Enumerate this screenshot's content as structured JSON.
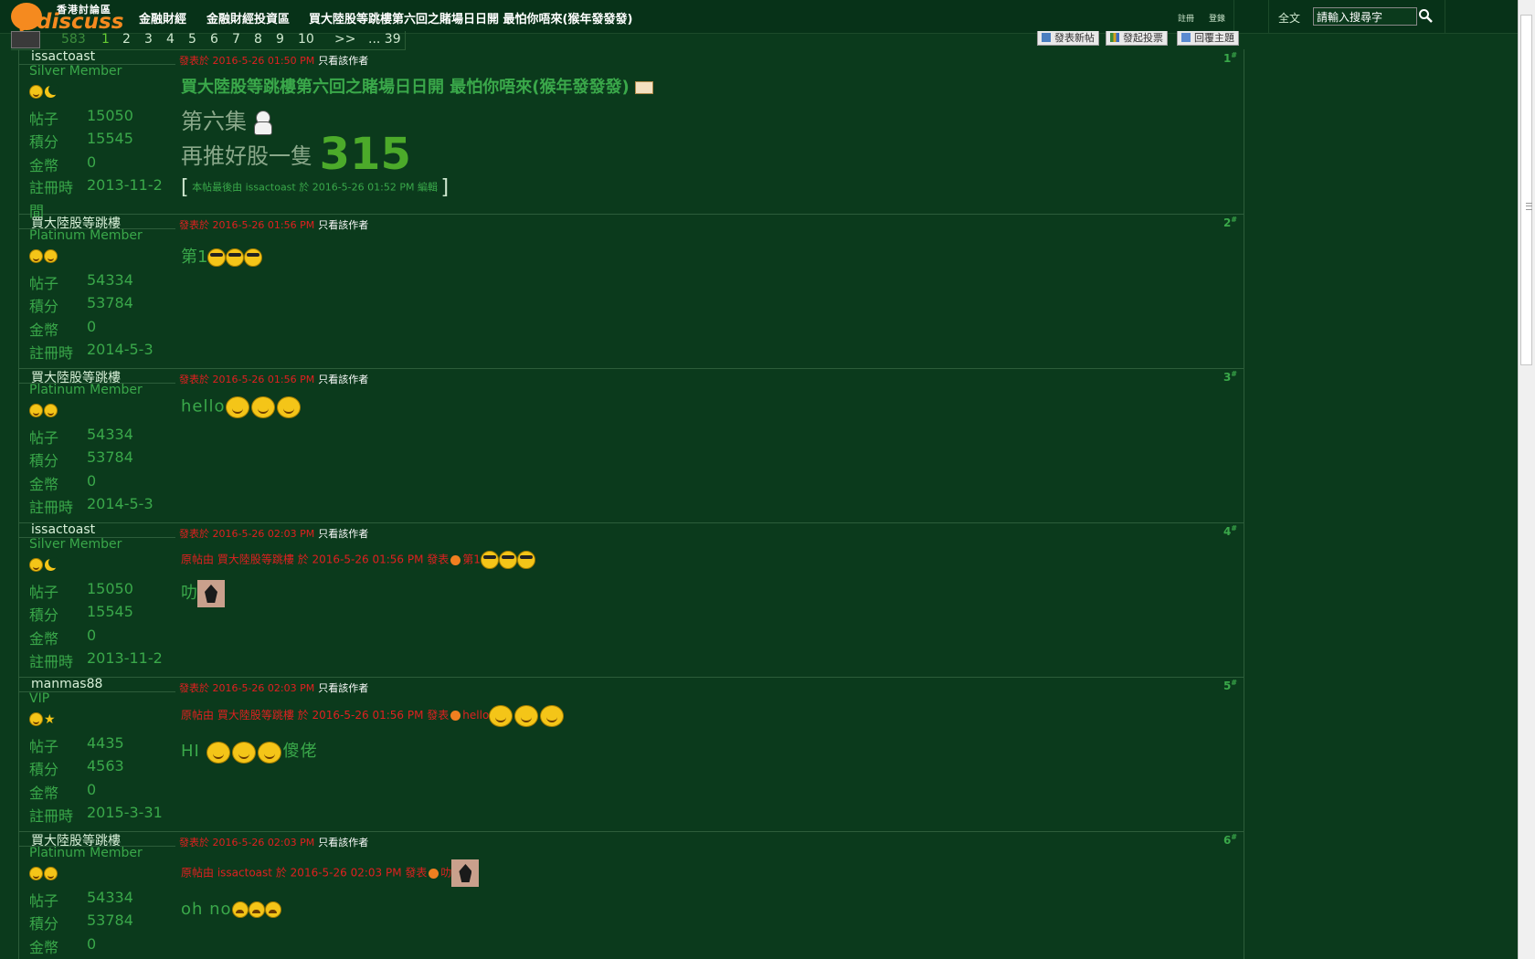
{
  "header": {
    "logo_cn": "香港討論區",
    "logo_en": "discuss",
    "nav": [
      "金融財經",
      "金融財經投資區",
      "買大陸股等跳樓第六回之賭場日日開 最怕你唔來(猴年發發發)"
    ],
    "tiny_links": [
      "註冊",
      "登錄"
    ],
    "search_label": "全文",
    "search_placeholder": "請輸入搜尋字"
  },
  "pager": {
    "total": "583",
    "pages": [
      "1",
      "2",
      "3",
      "4",
      "5",
      "6",
      "7",
      "8",
      "9",
      "10"
    ],
    "next": ">>",
    "last": "... 39"
  },
  "actions": [
    "發表新帖",
    "發起投票",
    "回覆主題"
  ],
  "posts": [
    {
      "author": "issactoast",
      "group": "Silver Member",
      "stats": {
        "posts_k": "帖子",
        "posts": "15050",
        "credits_k": "積分",
        "credits": "15545",
        "money_k": "金幣",
        "money": "0",
        "reg_k": "註冊時間",
        "reg": "2013-11-2"
      },
      "posted_label": "發表於",
      "time": "2016-5-26 01:50 PM",
      "only_author": "只看該作者",
      "floor": "1",
      "title": "買大陸股等跳樓第六回之賭場日日開 最怕你唔來(猴年發發發)",
      "line1": "第六集",
      "line2": "再推好股一隻",
      "stock": "315",
      "edit_note": "本帖最後由 issactoast 於 2016-5-26 01:52 PM 編輯"
    },
    {
      "author": "買大陸股等跳樓",
      "group": "Platinum Member",
      "stats": {
        "posts_k": "帖子",
        "posts": "54334",
        "credits_k": "積分",
        "credits": "53784",
        "money_k": "金幣",
        "money": "0",
        "reg_k": "註冊時",
        "reg": "2014-5-3"
      },
      "posted_label": "發表於",
      "time": "2016-5-26 01:56 PM",
      "only_author": "只看該作者",
      "floor": "2",
      "body": "第1"
    },
    {
      "author": "買大陸股等跳樓",
      "group": "Platinum Member",
      "stats": {
        "posts_k": "帖子",
        "posts": "54334",
        "credits_k": "積分",
        "credits": "53784",
        "money_k": "金幣",
        "money": "0",
        "reg_k": "註冊時",
        "reg": "2014-5-3"
      },
      "posted_label": "發表於",
      "time": "2016-5-26 01:56 PM",
      "only_author": "只看該作者",
      "floor": "3",
      "body": "hello"
    },
    {
      "author": "issactoast",
      "group": "Silver Member",
      "stats": {
        "posts_k": "帖子",
        "posts": "15050",
        "credits_k": "積分",
        "credits": "15545",
        "money_k": "金幣",
        "money": "0",
        "reg_k": "註冊時",
        "reg": "2013-11-2"
      },
      "posted_label": "發表於",
      "time": "2016-5-26 02:03 PM",
      "only_author": "只看該作者",
      "floor": "4",
      "quote": {
        "prefix": "原帖由",
        "user": "買大陸股等跳樓",
        "at": "於",
        "time": "2016-5-26 01:56 PM",
        "posted": "發表",
        "text": "第1"
      },
      "body": "叻"
    },
    {
      "author": "manmas88",
      "group": "VIP",
      "stats": {
        "posts_k": "帖子",
        "posts": "4435",
        "credits_k": "積分",
        "credits": "4563",
        "money_k": "金幣",
        "money": "0",
        "reg_k": "註冊時",
        "reg": "2015-3-31"
      },
      "posted_label": "發表於",
      "time": "2016-5-26 02:03 PM",
      "only_author": "只看該作者",
      "floor": "5",
      "quote": {
        "prefix": "原帖由",
        "user": "買大陸股等跳樓",
        "at": "於",
        "time": "2016-5-26 01:56 PM",
        "posted": "發表",
        "text": "hello"
      },
      "body_pre": "HI",
      "body_post": "傻佬"
    },
    {
      "author": "買大陸股等跳樓",
      "group": "Platinum Member",
      "stats": {
        "posts_k": "帖子",
        "posts": "54334",
        "credits_k": "積分",
        "credits": "53784",
        "money_k": "金幣",
        "money": "0"
      },
      "posted_label": "發表於",
      "time": "2016-5-26 02:03 PM",
      "only_author": "只看該作者",
      "floor": "6",
      "quote": {
        "prefix": "原帖由",
        "user": "issactoast",
        "at": "於",
        "time": "2016-5-26 02:03 PM",
        "posted": "發表",
        "text": "叻"
      },
      "body": "oh no"
    }
  ],
  "colors": {
    "background": "#0b3a1c",
    "accent_green": "#3aa84a",
    "meta_red": "#e02020",
    "logo_orange": "#f58a1f"
  }
}
